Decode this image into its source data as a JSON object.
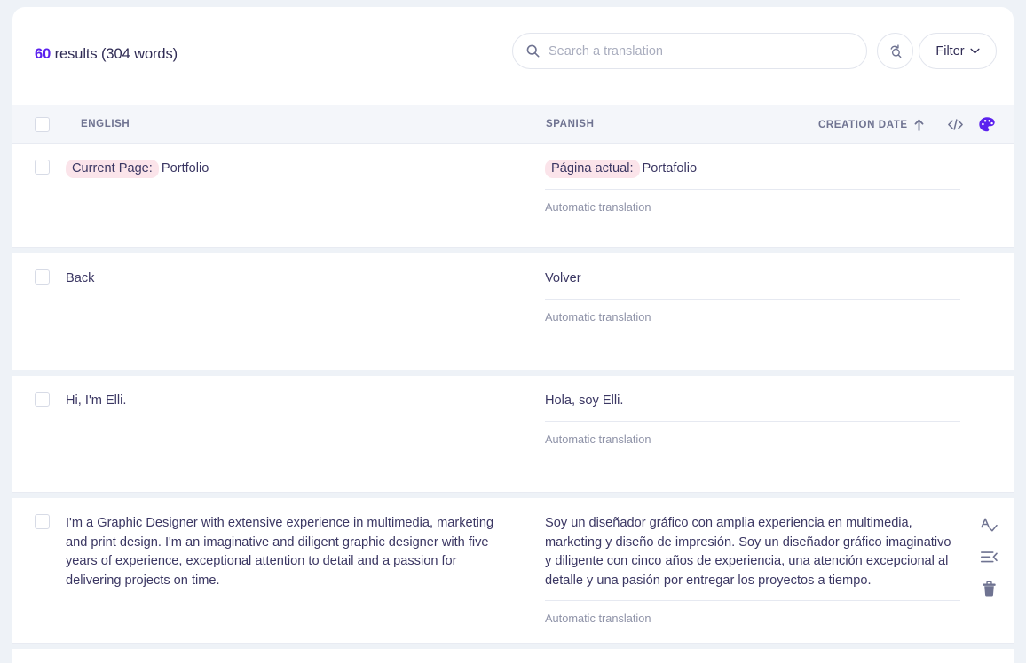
{
  "header": {
    "results_count": "60",
    "results_text": " results (304 words)",
    "search": {
      "placeholder": "Search a translation",
      "value": "",
      "icon": "search-icon"
    },
    "replace_button_icon": "search-replace-icon",
    "filter_label": "Filter",
    "filter_chevron": "chevron-down-icon"
  },
  "table": {
    "columns": {
      "english": "ENGLISH",
      "spanish": "SPANISH",
      "creation_date": "CREATION DATE"
    },
    "sort_direction_icon": "arrow-up-icon",
    "code_icon": "code-icon",
    "palette_icon": "palette-icon",
    "select_all_checkbox": "checkbox"
  },
  "colors": {
    "accent": "#5b21ee",
    "palette_icon": "#5b21ee",
    "pill_background": "#fbe4ea",
    "page_background": "#eef2f7",
    "header_row_background": "#f4f6fa",
    "text": "#3b3763",
    "muted_text": "#8f93a8"
  },
  "rows": [
    {
      "source_pill": "Current Page:",
      "source_text": "Portfolio",
      "target_pill": "Página actual:",
      "target_text": "Portafolio",
      "note": "Automatic translation"
    },
    {
      "source_pill": "",
      "source_text": "Back",
      "target_pill": "",
      "target_text": "Volver",
      "note": "Automatic translation"
    },
    {
      "source_pill": "",
      "source_text": "Hi, I'm Elli.",
      "target_pill": "",
      "target_text": "Hola, soy Elli.",
      "note": "Automatic translation"
    },
    {
      "source_pill": "",
      "source_text": "I'm a Graphic Designer with extensive experience in multimedia, marketing and print design. I'm an imaginative and diligent graphic designer with five years of experience, exceptional attention to detail and a passion for delivering projects on time.",
      "target_pill": "",
      "target_text": "Soy un diseñador gráfico con amplia experiencia en multimedia, marketing y diseño de impresión. Soy un diseñador gráfico imaginativo y diligente con cinco años de experiencia, una atención excepcional al detalle y una pasión por entregar los proyectos a tiempo.",
      "note": "Automatic translation",
      "actions": [
        "spellcheck-icon",
        "text-collapse-icon",
        "delete-icon"
      ]
    }
  ]
}
